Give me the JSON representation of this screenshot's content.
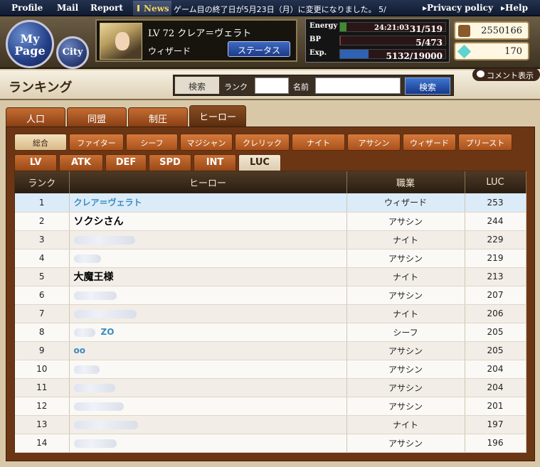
{
  "topnav": {
    "items": [
      "Profile",
      "Mail",
      "Report"
    ],
    "news_label": "News",
    "ticker": "ゲーム目の終了日が5月23日（月）に変更になりました。 5/",
    "privacy": "Privacy policy",
    "help": "Help"
  },
  "header": {
    "mypage": "My Page",
    "city": "City",
    "character": {
      "level_line": "LV 72 クレア＝ヴェラト",
      "class": "ウィザード",
      "status_button": "ステータス"
    },
    "stats": [
      {
        "label": "Energy",
        "value": "31/519",
        "timer": "24:21:03",
        "fill": 0.06,
        "color": "#3e8c32"
      },
      {
        "label": "BP",
        "value": "5/473",
        "fill": 0.01,
        "color": "#a83030"
      },
      {
        "label": "Exp.",
        "value": "5132/19000",
        "fill": 0.27,
        "color": "#2f62b5"
      }
    ],
    "gold": "2550166",
    "gems": "170"
  },
  "titlebar": {
    "title": "ランキング",
    "search_label": "検索",
    "rank_label": "ランク",
    "name_label": "名前",
    "search_button": "検索",
    "comment_button": "コメント表示"
  },
  "main_tabs": [
    "人口",
    "同盟",
    "制圧",
    "ヒーロー"
  ],
  "class_tabs": [
    "総合",
    "ファイター",
    "シーフ",
    "マジシャン",
    "クレリック",
    "ナイト",
    "アサシン",
    "ウィザード",
    "プリースト"
  ],
  "stat_tabs": [
    "LV",
    "ATK",
    "DEF",
    "SPD",
    "INT",
    "LUC"
  ],
  "table": {
    "headers": [
      "ランク",
      "ヒーロー",
      "職業",
      "LUC"
    ],
    "rows": [
      {
        "rank": "1",
        "name": "クレア＝ヴェラト",
        "job": "ウィザード",
        "luc": "253"
      },
      {
        "rank": "2",
        "name": "ソクシさん",
        "job": "アサシン",
        "luc": "244"
      },
      {
        "rank": "3",
        "name": "",
        "job": "ナイト",
        "luc": "229"
      },
      {
        "rank": "4",
        "name": "",
        "job": "アサシン",
        "luc": "219"
      },
      {
        "rank": "5",
        "name": "大魔王様",
        "job": "ナイト",
        "luc": "213"
      },
      {
        "rank": "6",
        "name": "",
        "job": "アサシン",
        "luc": "207"
      },
      {
        "rank": "7",
        "name": "",
        "job": "ナイト",
        "luc": "206"
      },
      {
        "rank": "8",
        "name": "ZO",
        "job": "シーフ",
        "luc": "205"
      },
      {
        "rank": "9",
        "name": "oo",
        "job": "アサシン",
        "luc": "205"
      },
      {
        "rank": "10",
        "name": "",
        "job": "アサシン",
        "luc": "204"
      },
      {
        "rank": "11",
        "name": "",
        "job": "アサシン",
        "luc": "204"
      },
      {
        "rank": "12",
        "name": "",
        "job": "アサシン",
        "luc": "201"
      },
      {
        "rank": "13",
        "name": "",
        "job": "ナイト",
        "luc": "197"
      },
      {
        "rank": "14",
        "name": "",
        "job": "アサシン",
        "luc": "196"
      }
    ]
  }
}
